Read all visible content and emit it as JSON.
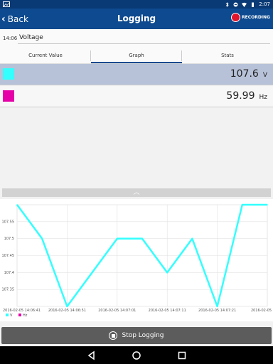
{
  "status_bar": {
    "time": "2:07"
  },
  "app_bar": {
    "back_label": "Back",
    "title": "Logging",
    "recording_label": "RECORDING"
  },
  "name_field": {
    "time": "14:06",
    "value": "Voltage"
  },
  "tabs": [
    {
      "label": "Current Value"
    },
    {
      "label": "Graph"
    },
    {
      "label": "Stats"
    }
  ],
  "active_tab": "Graph",
  "channels": [
    {
      "value": "107.6",
      "unit": "V",
      "color": "#33ffff"
    },
    {
      "value": "59.99",
      "unit": "Hz",
      "color": "#e600a8"
    }
  ],
  "stop_button": {
    "label": "Stop Logging"
  },
  "chart_data": {
    "type": "line",
    "x_ticks": [
      "2016-02-05 14:06:41",
      "2016-02-05 14:06:51",
      "2016-02-05 14:07:01",
      "2016-02-05 14:07:11",
      "2016-02-05 14:07:21",
      "2016-02-05"
    ],
    "y_ticks": [
      "107.55",
      "107.5",
      "107.45",
      "107.4",
      "107.35"
    ],
    "ylim": [
      107.3,
      107.6
    ],
    "legend": [
      {
        "name": "V",
        "color": "#33ffff"
      },
      {
        "name": "Hz",
        "color": "#e600a8"
      }
    ],
    "series": [
      {
        "name": "V",
        "color": "#33ffff",
        "x": [
          0,
          5,
          10,
          15,
          20,
          25,
          30,
          35,
          40,
          45,
          50
        ],
        "y": [
          107.6,
          107.5,
          107.3,
          107.4,
          107.5,
          107.5,
          107.4,
          107.5,
          107.3,
          107.6,
          107.6
        ]
      }
    ],
    "x_range_seconds": [
      0,
      50
    ]
  }
}
